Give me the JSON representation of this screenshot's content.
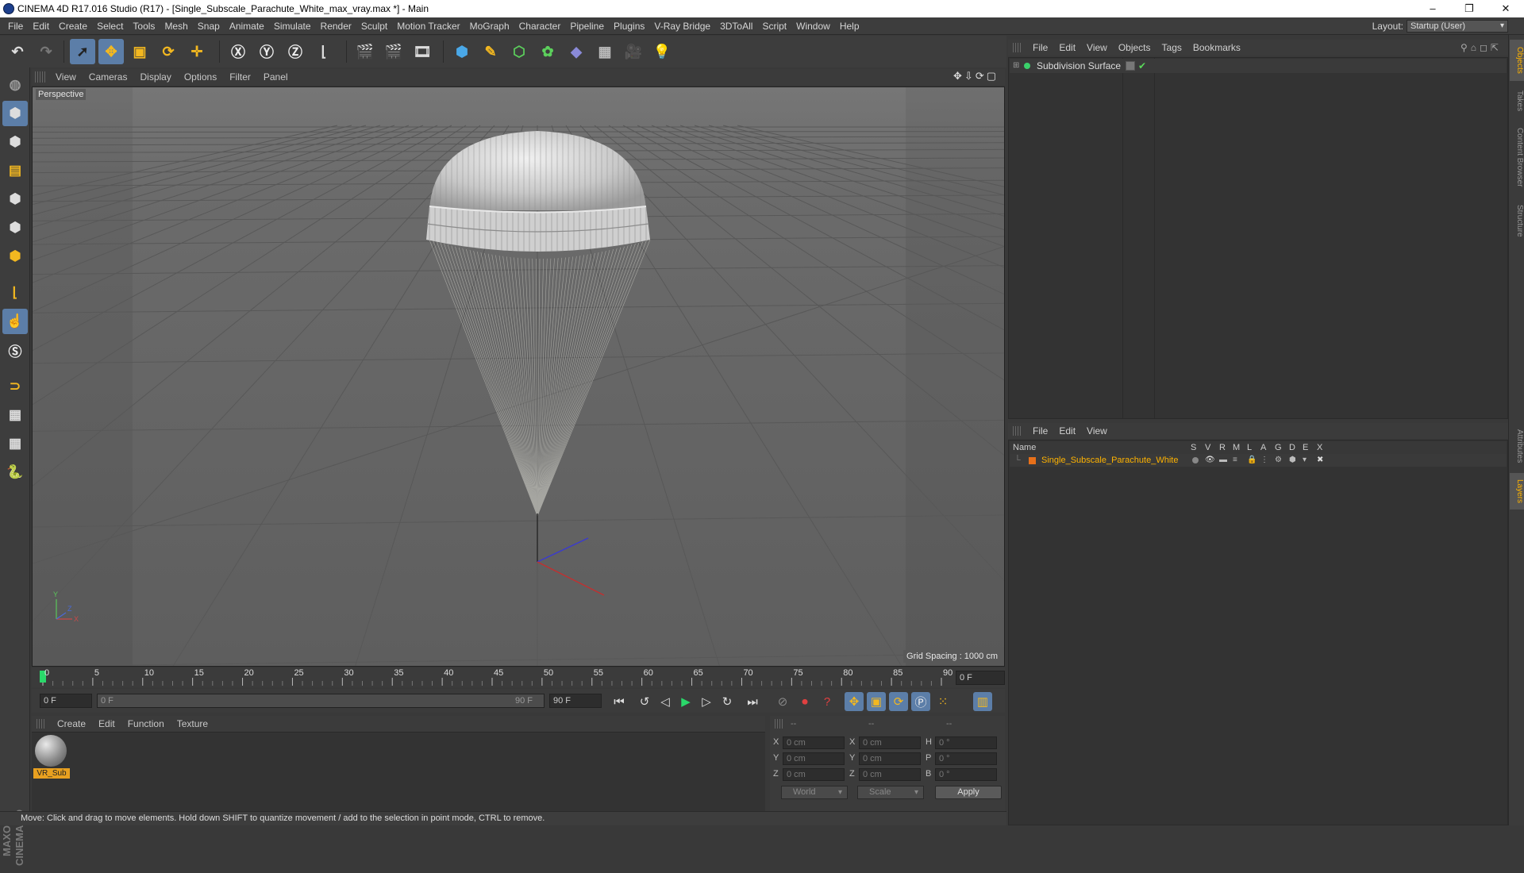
{
  "window": {
    "title": "CINEMA 4D R17.016 Studio (R17) - [Single_Subscale_Parachute_White_max_vray.max *] - Main",
    "minimize": "–",
    "restore": "❐",
    "close": "✕"
  },
  "menubar": {
    "items": [
      "File",
      "Edit",
      "Create",
      "Select",
      "Tools",
      "Mesh",
      "Snap",
      "Animate",
      "Simulate",
      "Render",
      "Sculpt",
      "Motion Tracker",
      "MoGraph",
      "Character",
      "Pipeline",
      "Plugins",
      "V-Ray Bridge",
      "3DToAll",
      "Script",
      "Window",
      "Help"
    ],
    "layout_label": "Layout:",
    "layout_value": "Startup (User)"
  },
  "viewport": {
    "menu": [
      "View",
      "Cameras",
      "Display",
      "Options",
      "Filter",
      "Panel"
    ],
    "label": "Perspective",
    "grid_spacing": "Grid Spacing : 1000 cm"
  },
  "timeline": {
    "ticks": [
      "0",
      "5",
      "10",
      "15",
      "20",
      "25",
      "30",
      "35",
      "40",
      "45",
      "50",
      "55",
      "60",
      "65",
      "70",
      "75",
      "80",
      "85",
      "90"
    ],
    "current_frame": "0 F",
    "start_field": "0 F",
    "range_start": "0 F",
    "range_end": "90 F",
    "end_field": "90 F"
  },
  "material_manager": {
    "menu": [
      "Create",
      "Edit",
      "Function",
      "Texture"
    ],
    "material_name": "VR_Sub"
  },
  "coordinates": {
    "head": [
      "--",
      "--",
      "--"
    ],
    "rows": [
      {
        "a": "X",
        "av": "0 cm",
        "b": "X",
        "bv": "0 cm",
        "c": "H",
        "cv": "0 °"
      },
      {
        "a": "Y",
        "av": "0 cm",
        "b": "Y",
        "bv": "0 cm",
        "c": "P",
        "cv": "0 °"
      },
      {
        "a": "Z",
        "av": "0 cm",
        "b": "Z",
        "bv": "0 cm",
        "c": "B",
        "cv": "0 °"
      }
    ],
    "world": "World",
    "scale": "Scale",
    "apply": "Apply"
  },
  "status": "Move: Click and drag to move elements. Hold down SHIFT to quantize movement / add to the selection in point mode, CTRL to remove.",
  "object_manager": {
    "menu": [
      "File",
      "Edit",
      "View",
      "Objects",
      "Tags",
      "Bookmarks"
    ],
    "object_name": "Subdivision Surface"
  },
  "layer_manager": {
    "menu": [
      "File",
      "Edit",
      "View"
    ],
    "name_col": "Name",
    "flags": [
      "S",
      "V",
      "R",
      "M",
      "L",
      "A",
      "G",
      "D",
      "E",
      "X"
    ],
    "layer_name": "Single_Subscale_Parachute_White"
  },
  "side_tabs": [
    "Objects",
    "Takes",
    "Content Browser",
    "Structure",
    "Attributes",
    "Layers"
  ],
  "colors": {
    "accent": "#5c7ea8",
    "layer_text": "#ffb300",
    "mat_tag": "#e8a020"
  }
}
